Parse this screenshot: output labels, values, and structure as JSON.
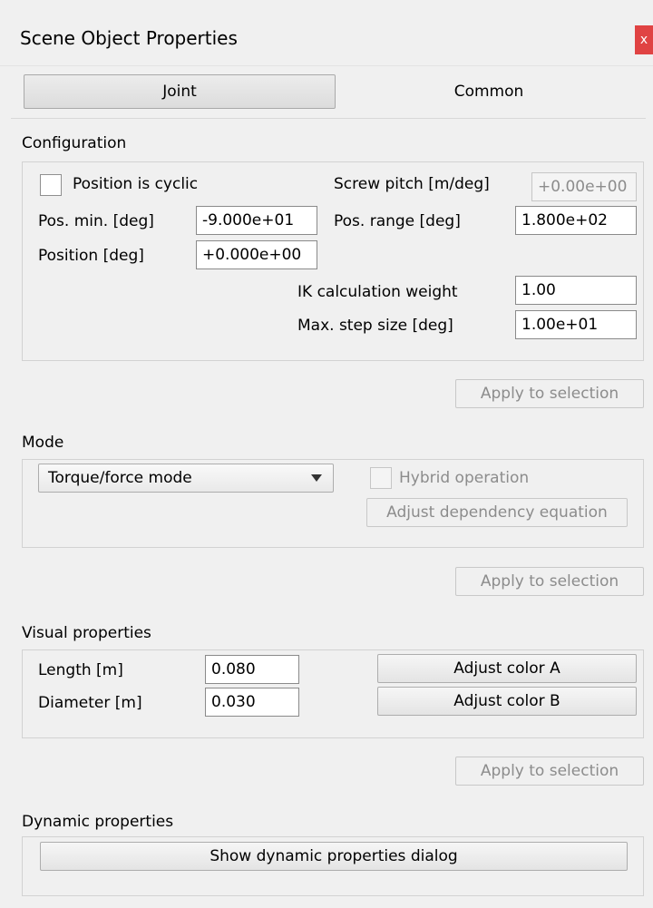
{
  "window": {
    "title": "Scene Object Properties",
    "close_glyph": "x"
  },
  "tabs": [
    {
      "label": "Joint",
      "active": true
    },
    {
      "label": "Common",
      "active": false
    }
  ],
  "configuration": {
    "section_label": "Configuration",
    "position_cyclic": {
      "label": "Position is cyclic",
      "checked": false
    },
    "screw_pitch": {
      "label": "Screw pitch [m/deg]",
      "value": "+0.00e+00",
      "enabled": false
    },
    "pos_min": {
      "label": "Pos. min. [deg]",
      "value": "-9.000e+01"
    },
    "pos_range": {
      "label": "Pos. range [deg]",
      "value": "1.800e+02"
    },
    "position": {
      "label": "Position [deg]",
      "value": "+0.000e+00"
    },
    "ik_weight": {
      "label": "IK calculation weight",
      "value": "1.00"
    },
    "max_step": {
      "label": "Max. step size [deg]",
      "value": "1.00e+01"
    },
    "apply_label": "Apply to selection"
  },
  "mode": {
    "section_label": "Mode",
    "selected": "Torque/force mode",
    "hybrid": {
      "label": "Hybrid operation",
      "checked": false,
      "enabled": false
    },
    "adjust_dependency_label": "Adjust dependency equation",
    "apply_label": "Apply to selection"
  },
  "visual": {
    "section_label": "Visual properties",
    "length": {
      "label": "Length [m]",
      "value": "0.080"
    },
    "diameter": {
      "label": "Diameter [m]",
      "value": "0.030"
    },
    "color_a_label": "Adjust color A",
    "color_b_label": "Adjust color B",
    "apply_label": "Apply to selection"
  },
  "dynamic": {
    "section_label": "Dynamic properties",
    "show_dialog_label": "Show dynamic properties dialog"
  },
  "icons": {
    "close": "close-icon",
    "dropdown": "chevron-down-icon"
  },
  "colors": {
    "close_button": "#e04343",
    "background": "#f0f0f0",
    "disabled_text": "#8c8c8c"
  }
}
